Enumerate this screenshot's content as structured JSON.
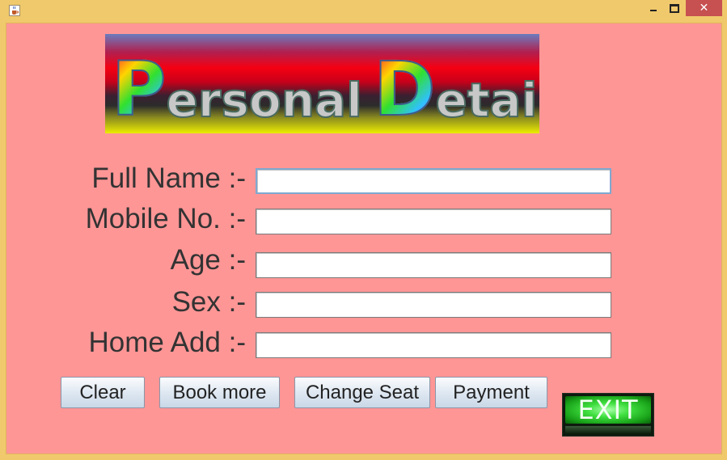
{
  "window": {
    "icon": "java-cup-icon",
    "controls": {
      "minimize": "minimize-icon",
      "maximize": "maximize-icon",
      "close_glyph": "✕"
    }
  },
  "banner": {
    "first_letter": "P",
    "first_rest": "ersonal",
    "second_letter": "D",
    "second_rest": "etail"
  },
  "form": {
    "full_name": {
      "label": "Full Name :-",
      "value": ""
    },
    "mobile": {
      "label": "Mobile No. :-",
      "value": ""
    },
    "age": {
      "label": "Age :-",
      "value": ""
    },
    "sex": {
      "label": "Sex :-",
      "value": ""
    },
    "home_add": {
      "label": "Home Add :-",
      "value": ""
    }
  },
  "buttons": {
    "clear": "Clear",
    "book_more": "Book more",
    "change_seat": "Change Seat",
    "payment": "Payment",
    "exit": "EXIT"
  },
  "colors": {
    "background": "#ff9696",
    "titlebar": "#f0c96c",
    "close_button": "#c75050",
    "exit_green": "#40e040"
  }
}
